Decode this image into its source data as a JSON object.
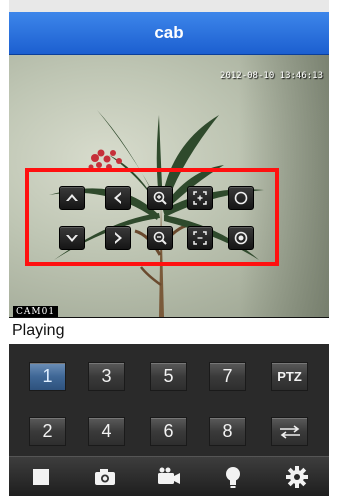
{
  "app": {
    "title": "cab"
  },
  "video": {
    "timestamp": "2012-08-10 13:46:13",
    "camera_label": "CAM01"
  },
  "ptz_controls": [
    {
      "name": "tilt-up-button",
      "icon": "arrow-up-icon"
    },
    {
      "name": "pan-left-button",
      "icon": "arrow-left-icon"
    },
    {
      "name": "zoom-in-button",
      "icon": "zoom-in-icon"
    },
    {
      "name": "focus-near-button",
      "icon": "focus-in-icon"
    },
    {
      "name": "iris-open-button",
      "icon": "iris-ring-icon"
    },
    {
      "name": "tilt-down-button",
      "icon": "arrow-down-icon"
    },
    {
      "name": "pan-right-button",
      "icon": "arrow-right-icon"
    },
    {
      "name": "zoom-out-button",
      "icon": "zoom-out-icon"
    },
    {
      "name": "focus-far-button",
      "icon": "focus-out-icon"
    },
    {
      "name": "iris-close-button",
      "icon": "iris-dot-icon"
    }
  ],
  "status": {
    "text": "Playing"
  },
  "channels": {
    "row1": [
      "1",
      "3",
      "5",
      "7",
      "PTZ"
    ],
    "row2": [
      "2",
      "4",
      "6",
      "8",
      "swap"
    ],
    "active": "1"
  },
  "toolbar": [
    {
      "name": "stop-button",
      "icon": "stop-icon"
    },
    {
      "name": "snapshot-button",
      "icon": "camera-icon"
    },
    {
      "name": "record-button",
      "icon": "video-camera-icon"
    },
    {
      "name": "light-button",
      "icon": "lightbulb-icon"
    },
    {
      "name": "settings-button",
      "icon": "gear-icon"
    }
  ],
  "colors": {
    "title_bar": "#2a6fe0",
    "ptz_highlight": "#ff1010",
    "active_channel": "#3f6796"
  }
}
